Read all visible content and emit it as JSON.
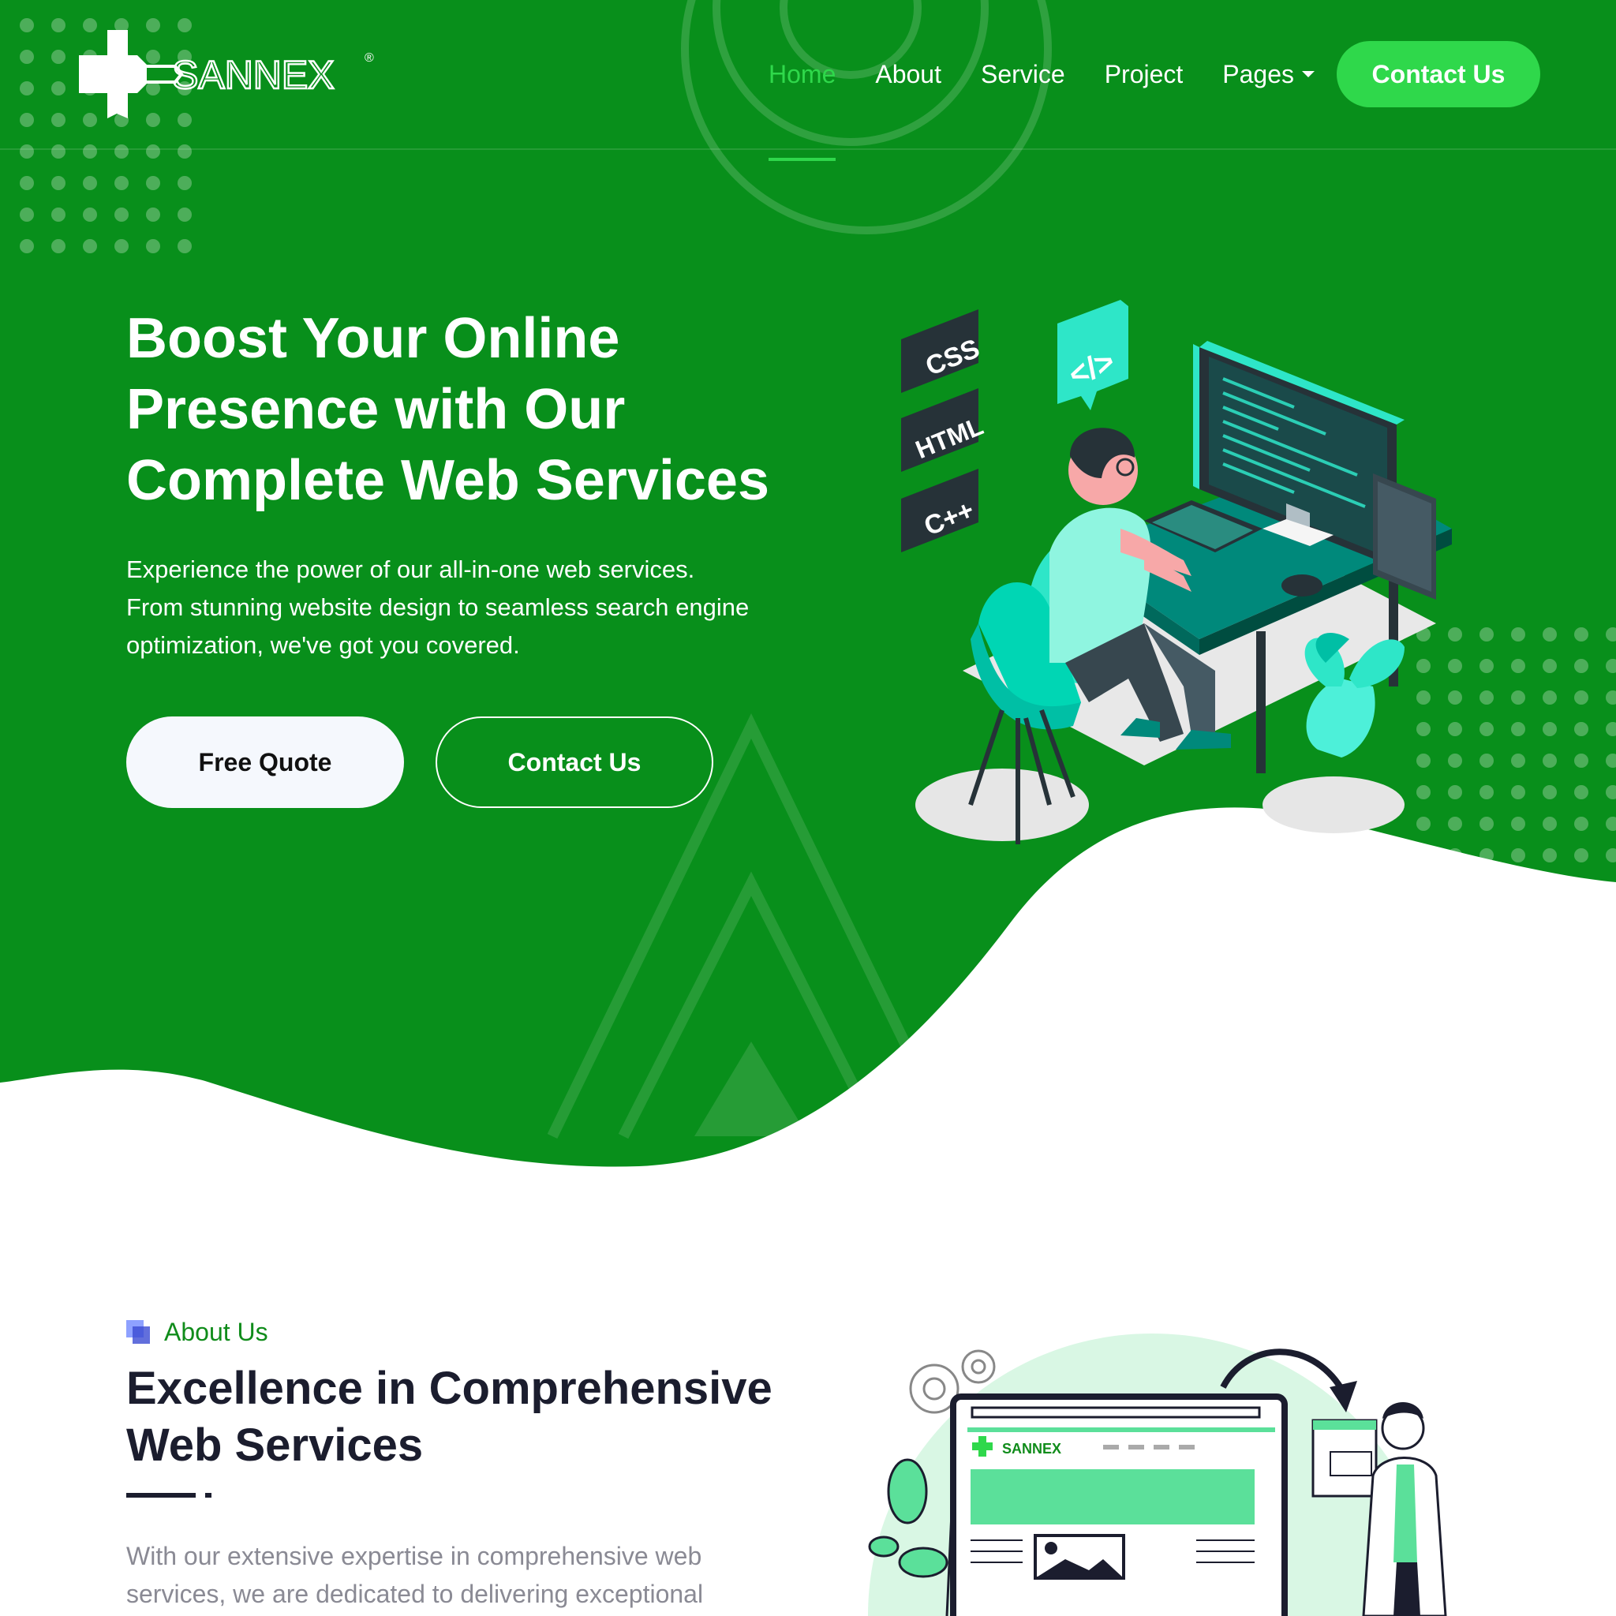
{
  "brand": {
    "name": "SANNEX",
    "mark": "®"
  },
  "nav": {
    "items": [
      {
        "label": "Home",
        "active": true
      },
      {
        "label": "About",
        "active": false
      },
      {
        "label": "Service",
        "active": false
      },
      {
        "label": "Project",
        "active": false
      },
      {
        "label": "Pages",
        "active": false,
        "dropdown": true
      }
    ],
    "cta_label": "Contact Us"
  },
  "hero": {
    "title_lines": [
      "Boost Your Online",
      "Presence with Our",
      "Complete Web Services"
    ],
    "text_lines": [
      "Experience the power of our all-in-one web services.",
      "From stunning website design to seamless search engine",
      "optimization, we've got you covered."
    ],
    "primary_button": "Free Quote",
    "secondary_button": "Contact Us",
    "illustration_labels": [
      "CSS",
      "HTML",
      "C++",
      "</>"
    ]
  },
  "about": {
    "eyebrow": "About Us",
    "title_lines": [
      "Excellence in Comprehensive",
      "Web Services"
    ],
    "text_lines": [
      "With our extensive expertise in comprehensive web",
      "services, we are dedicated to delivering exceptional"
    ],
    "illustration_brand": "SANNEX"
  },
  "colors": {
    "hero_green": "#088f1b",
    "accent_green": "#2fd84b",
    "teal": "#2ee6c8",
    "heading_dark": "#1b1d2e",
    "muted_text": "#8a8a94",
    "eyebrow_green": "#108c1b"
  }
}
